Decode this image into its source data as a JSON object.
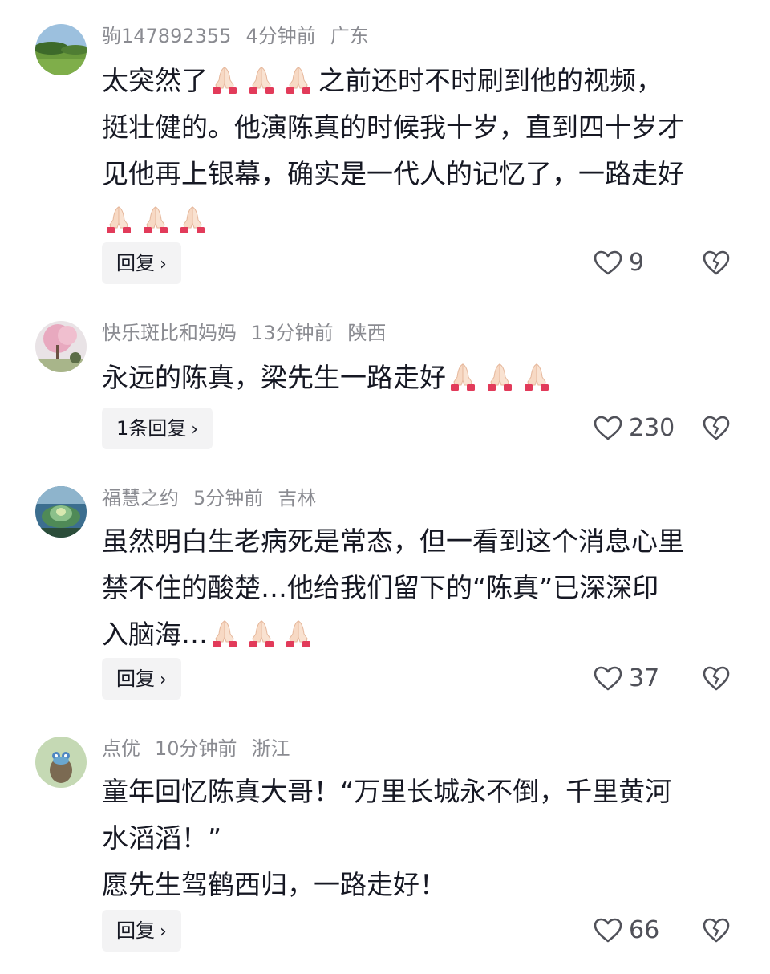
{
  "comments": [
    {
      "user": "驹147892355",
      "time": "4分钟前",
      "location": "广东",
      "lines": [
        "太突然了",
        "之前还时不时刷到他的视频，",
        "挺壮健的。他演陈真的时候我十岁，直到四十岁才",
        "见他再上银幕，确实是一代人的记忆了，一路走好"
      ],
      "reply_label": "回复",
      "likes": "9"
    },
    {
      "user": "快乐斑比和妈妈",
      "time": "13分钟前",
      "location": "陕西",
      "lines": [
        "永远的陈真，梁先生一路走好"
      ],
      "reply_label": "1条回复",
      "likes": "230"
    },
    {
      "user": "福慧之约",
      "time": "5分钟前",
      "location": "吉林",
      "lines": [
        "虽然明白生老病死是常态，但一看到这个消息心里",
        "禁不住的酸楚…他给我们留下的“陈真”已深深印",
        "入脑海…"
      ],
      "reply_label": "回复",
      "likes": "37"
    },
    {
      "user": "点优",
      "time": "10分钟前",
      "location": "浙江",
      "lines": [
        "童年回忆陈真大哥！“万里长城永不倒，千里黄河",
        "水滔滔！”",
        "愿先生驾鹤西归，一路走好！"
      ],
      "reply_label": "回复",
      "likes": "66"
    }
  ],
  "icons": {
    "emoji": "folded-hands",
    "like": "heart-outline-icon",
    "dislike": "broken-heart-icon"
  },
  "colors": {
    "text": "#161823",
    "meta": "#8a8b91",
    "reply_bg": "#f3f3f4"
  }
}
